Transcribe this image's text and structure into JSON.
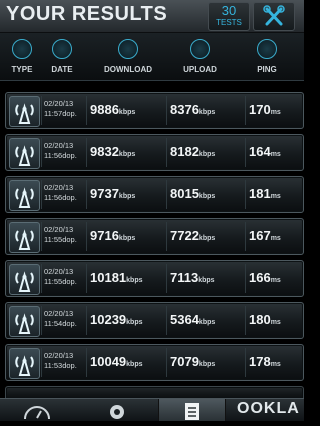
{
  "header": {
    "title": "YOUR RESULTS",
    "tests_count": "30",
    "tests_label": "TESTS"
  },
  "columns": [
    {
      "label": "TYPE",
      "icon": "antenna-icon"
    },
    {
      "label": "DATE",
      "icon": "calendar-icon"
    },
    {
      "label": "DOWNLOAD",
      "icon": "download-arrow-icon"
    },
    {
      "label": "UPLOAD",
      "icon": "upload-arrow-icon"
    },
    {
      "label": "PING",
      "icon": "ping-arrows-icon"
    }
  ],
  "units": {
    "speed": "kbps",
    "ping": "ms"
  },
  "rows": [
    {
      "date": "02/20/13",
      "time": "11:57dop.",
      "download": "9886",
      "upload": "8376",
      "ping": "170"
    },
    {
      "date": "02/20/13",
      "time": "11:56dop.",
      "download": "9832",
      "upload": "8182",
      "ping": "164"
    },
    {
      "date": "02/20/13",
      "time": "11:56dop.",
      "download": "9737",
      "upload": "8015",
      "ping": "181"
    },
    {
      "date": "02/20/13",
      "time": "11:55dop.",
      "download": "9716",
      "upload": "7722",
      "ping": "167"
    },
    {
      "date": "02/20/13",
      "time": "11:55dop.",
      "download": "10181",
      "upload": "7113",
      "ping": "166"
    },
    {
      "date": "02/20/13",
      "time": "11:54dop.",
      "download": "10239",
      "upload": "5364",
      "ping": "180"
    },
    {
      "date": "02/20/13",
      "time": "11:53dop.",
      "download": "10049",
      "upload": "7079",
      "ping": "178"
    }
  ],
  "footer": {
    "tabs": [
      "speedometer-icon",
      "settings-gear-icon",
      "results-list-icon"
    ],
    "brand": "OOKLA"
  },
  "colors": {
    "accent": "#35b4dd",
    "background": "#000000"
  }
}
